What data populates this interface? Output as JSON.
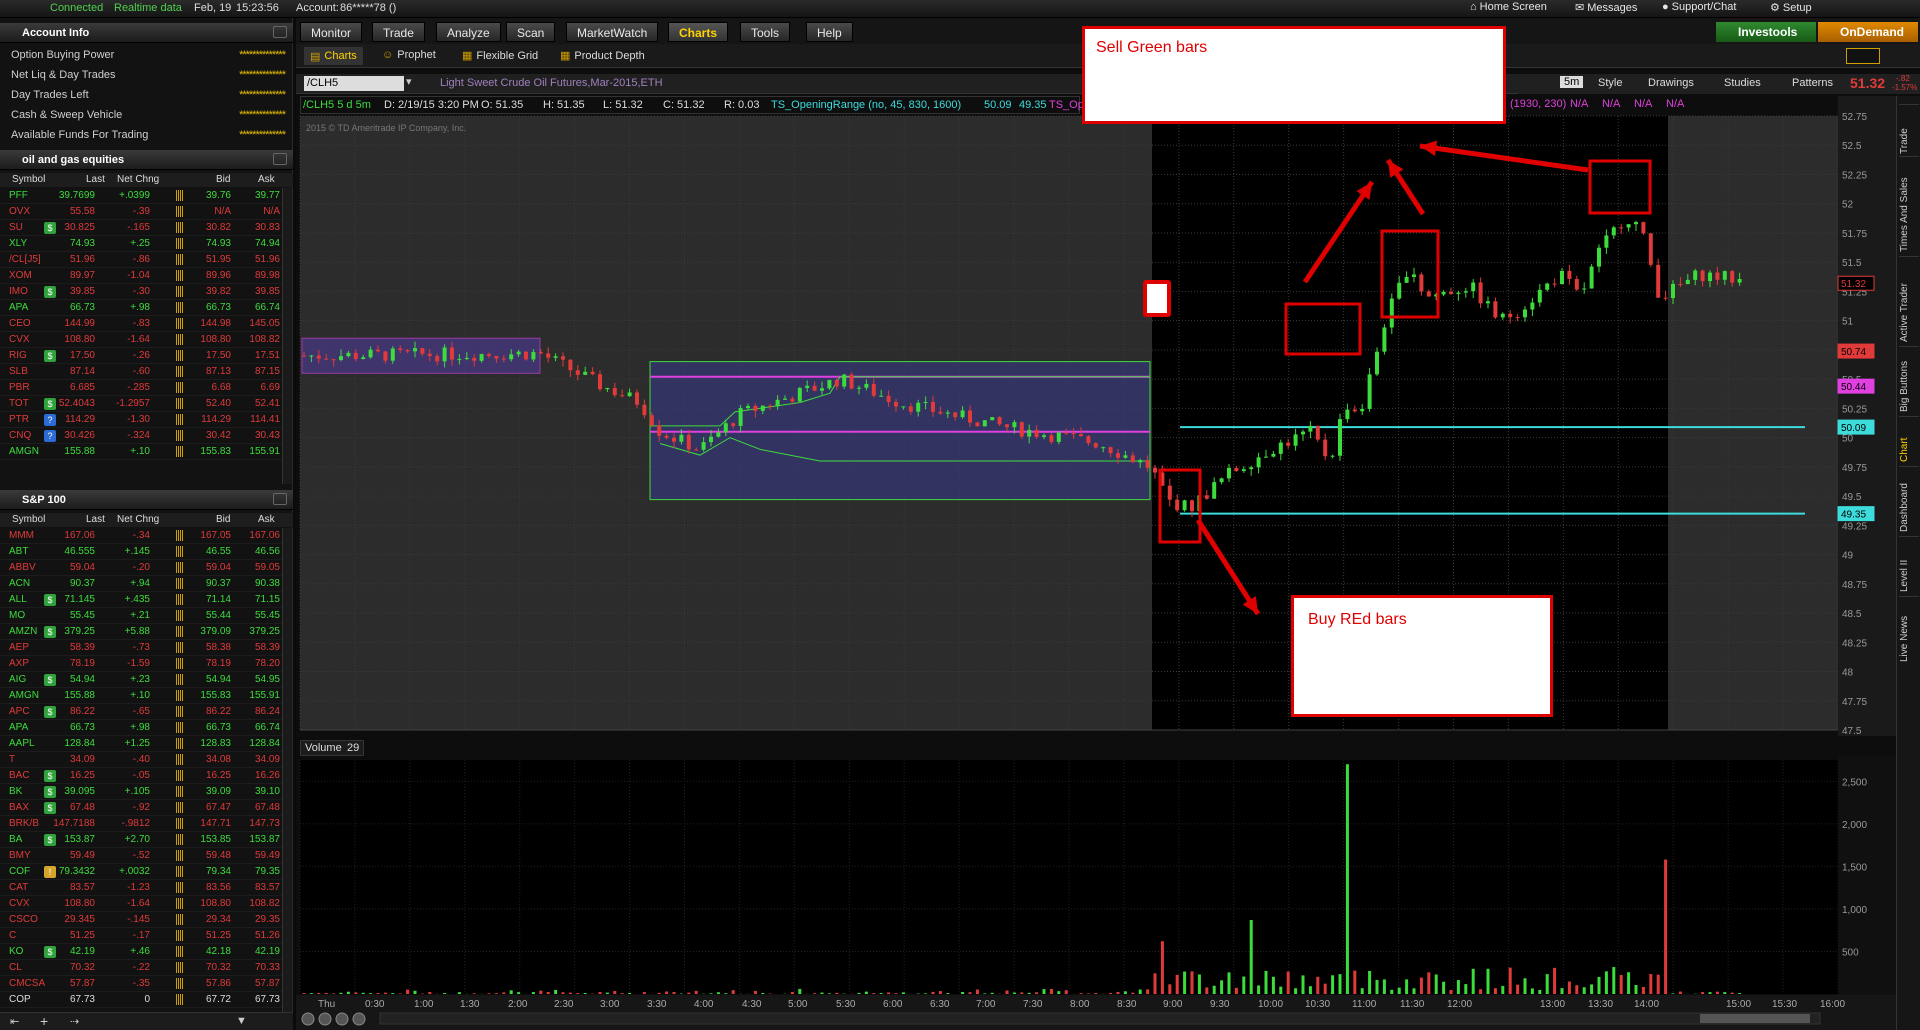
{
  "topbar": {
    "connected": "Connected",
    "realtime": "Realtime data",
    "date": "Feb, 19",
    "time": "15:23:56",
    "account_label": "Account:",
    "account": "86*****78 ()",
    "home": "Home Screen",
    "messages": "Messages",
    "support": "Support/Chat",
    "setup": "Setup"
  },
  "account_info": {
    "title": "Account Info",
    "rows": [
      {
        "label": "Option Buying Power"
      },
      {
        "label": "Net Liq & Day Trades"
      },
      {
        "label": "Day Trades Left"
      },
      {
        "label": "Cash & Sweep Vehicle"
      },
      {
        "label": "Available Funds For Trading"
      }
    ],
    "mask": "**************"
  },
  "columns": {
    "symbol": "Symbol",
    "last": "Last",
    "chg": "Net Chng",
    "bid": "Bid",
    "ask": "Ask"
  },
  "watch1": {
    "title": "oil and gas equities",
    "rows": [
      {
        "s": "PFF",
        "l": "39.7699",
        "c": "+.0399",
        "b": "39.76",
        "a": "39.77",
        "d": "up"
      },
      {
        "s": "OVX",
        "l": "55.58",
        "c": "-.39",
        "b": "N/A",
        "a": "N/A",
        "d": "dn"
      },
      {
        "s": "SU",
        "l": "30.825",
        "c": "-.165",
        "b": "30.82",
        "a": "30.83",
        "d": "dn",
        "badge": "$"
      },
      {
        "s": "XLY",
        "l": "74.93",
        "c": "+.25",
        "b": "74.93",
        "a": "74.94",
        "d": "up"
      },
      {
        "s": "/CL[J5]",
        "l": "51.96",
        "c": "-.86",
        "b": "51.95",
        "a": "51.96",
        "d": "dn"
      },
      {
        "s": "XOM",
        "l": "89.97",
        "c": "-1.04",
        "b": "89.96",
        "a": "89.98",
        "d": "dn"
      },
      {
        "s": "IMO",
        "l": "39.85",
        "c": "-.30",
        "b": "39.82",
        "a": "39.85",
        "d": "dn",
        "badge": "$"
      },
      {
        "s": "APA",
        "l": "66.73",
        "c": "+.98",
        "b": "66.73",
        "a": "66.74",
        "d": "up"
      },
      {
        "s": "CEO",
        "l": "144.99",
        "c": "-.83",
        "b": "144.98",
        "a": "145.05",
        "d": "dn"
      },
      {
        "s": "CVX",
        "l": "108.80",
        "c": "-1.64",
        "b": "108.80",
        "a": "108.82",
        "d": "dn"
      },
      {
        "s": "RIG",
        "l": "17.50",
        "c": "-.26",
        "b": "17.50",
        "a": "17.51",
        "d": "dn",
        "badge": "$"
      },
      {
        "s": "SLB",
        "l": "87.14",
        "c": "-.60",
        "b": "87.13",
        "a": "87.15",
        "d": "dn"
      },
      {
        "s": "PBR",
        "l": "6.685",
        "c": "-.285",
        "b": "6.68",
        "a": "6.69",
        "d": "dn"
      },
      {
        "s": "TOT",
        "l": "52.4043",
        "c": "-1.2957",
        "b": "52.40",
        "a": "52.41",
        "d": "dn",
        "badge": "$"
      },
      {
        "s": "PTR",
        "l": "114.29",
        "c": "-1.30",
        "b": "114.29",
        "a": "114.41",
        "d": "dn",
        "badge": "?"
      },
      {
        "s": "CNQ",
        "l": "30.426",
        "c": "-.324",
        "b": "30.42",
        "a": "30.43",
        "d": "dn",
        "badge": "?"
      },
      {
        "s": "AMGN",
        "l": "155.88",
        "c": "+.10",
        "b": "155.83",
        "a": "155.91",
        "d": "up"
      }
    ]
  },
  "watch2": {
    "title": "S&P 100",
    "rows": [
      {
        "s": "MMM",
        "l": "167.06",
        "c": "-.34",
        "b": "167.05",
        "a": "167.06",
        "d": "dn"
      },
      {
        "s": "ABT",
        "l": "46.555",
        "c": "+.145",
        "b": "46.55",
        "a": "46.56",
        "d": "up"
      },
      {
        "s": "ABBV",
        "l": "59.04",
        "c": "-.20",
        "b": "59.04",
        "a": "59.05",
        "d": "dn"
      },
      {
        "s": "ACN",
        "l": "90.37",
        "c": "+.94",
        "b": "90.37",
        "a": "90.38",
        "d": "up"
      },
      {
        "s": "ALL",
        "l": "71.145",
        "c": "+.435",
        "b": "71.14",
        "a": "71.15",
        "d": "up",
        "badge": "$"
      },
      {
        "s": "MO",
        "l": "55.45",
        "c": "+.21",
        "b": "55.44",
        "a": "55.45",
        "d": "up"
      },
      {
        "s": "AMZN",
        "l": "379.25",
        "c": "+5.88",
        "b": "379.09",
        "a": "379.25",
        "d": "up",
        "badge": "$"
      },
      {
        "s": "AEP",
        "l": "58.39",
        "c": "-.73",
        "b": "58.38",
        "a": "58.39",
        "d": "dn"
      },
      {
        "s": "AXP",
        "l": "78.19",
        "c": "-1.59",
        "b": "78.19",
        "a": "78.20",
        "d": "dn"
      },
      {
        "s": "AIG",
        "l": "54.94",
        "c": "+.23",
        "b": "54.94",
        "a": "54.95",
        "d": "up",
        "badge": "$"
      },
      {
        "s": "AMGN",
        "l": "155.88",
        "c": "+.10",
        "b": "155.83",
        "a": "155.91",
        "d": "up"
      },
      {
        "s": "APC",
        "l": "86.22",
        "c": "-.65",
        "b": "86.22",
        "a": "86.24",
        "d": "dn",
        "badge": "$"
      },
      {
        "s": "APA",
        "l": "66.73",
        "c": "+.98",
        "b": "66.73",
        "a": "66.74",
        "d": "up"
      },
      {
        "s": "AAPL",
        "l": "128.84",
        "c": "+1.25",
        "b": "128.83",
        "a": "128.84",
        "d": "up"
      },
      {
        "s": "T",
        "l": "34.09",
        "c": "-.40",
        "b": "34.08",
        "a": "34.09",
        "d": "dn"
      },
      {
        "s": "BAC",
        "l": "16.25",
        "c": "-.05",
        "b": "16.25",
        "a": "16.26",
        "d": "dn",
        "badge": "$"
      },
      {
        "s": "BK",
        "l": "39.095",
        "c": "+.105",
        "b": "39.09",
        "a": "39.10",
        "d": "up",
        "badge": "$"
      },
      {
        "s": "BAX",
        "l": "67.48",
        "c": "-.92",
        "b": "67.47",
        "a": "67.48",
        "d": "dn",
        "badge": "$"
      },
      {
        "s": "BRK/B",
        "l": "147.7188",
        "c": "-.9812",
        "b": "147.71",
        "a": "147.73",
        "d": "dn"
      },
      {
        "s": "BA",
        "l": "153.87",
        "c": "+2.70",
        "b": "153.85",
        "a": "153.87",
        "d": "up",
        "badge": "$"
      },
      {
        "s": "BMY",
        "l": "59.49",
        "c": "-.52",
        "b": "59.48",
        "a": "59.49",
        "d": "dn"
      },
      {
        "s": "COF",
        "l": "79.3432",
        "c": "+.0032",
        "b": "79.34",
        "a": "79.35",
        "d": "up",
        "badge": "!"
      },
      {
        "s": "CAT",
        "l": "83.57",
        "c": "-1.23",
        "b": "83.56",
        "a": "83.57",
        "d": "dn"
      },
      {
        "s": "CVX",
        "l": "108.80",
        "c": "-1.64",
        "b": "108.80",
        "a": "108.82",
        "d": "dn"
      },
      {
        "s": "CSCO",
        "l": "29.345",
        "c": "-.145",
        "b": "29.34",
        "a": "29.35",
        "d": "dn"
      },
      {
        "s": "C",
        "l": "51.25",
        "c": "-.17",
        "b": "51.25",
        "a": "51.26",
        "d": "dn"
      },
      {
        "s": "KO",
        "l": "42.19",
        "c": "+.46",
        "b": "42.18",
        "a": "42.19",
        "d": "up",
        "badge": "$"
      },
      {
        "s": "CL",
        "l": "70.32",
        "c": "-.22",
        "b": "70.32",
        "a": "70.33",
        "d": "dn"
      },
      {
        "s": "CMCSA",
        "l": "57.87",
        "c": "-.35",
        "b": "57.86",
        "a": "57.87",
        "d": "dn"
      },
      {
        "s": "COP",
        "l": "67.73",
        "c": "0",
        "b": "67.72",
        "a": "67.73",
        "d": "wh"
      }
    ]
  },
  "tabs": [
    "Monitor",
    "Trade",
    "Analyze",
    "Scan",
    "MarketWatch",
    "Charts",
    "Tools",
    "Help"
  ],
  "selected_tab": "Charts",
  "subtabs": [
    "Charts",
    "Prophet",
    "Flexible Grid",
    "Product Depth"
  ],
  "investools": "Investools",
  "ondemand": "OnDemand",
  "chart": {
    "symbol": "/CLH5",
    "desc": "Light Sweet Crude Oil Futures,Mar-2015,ETH",
    "period": "5m",
    "style": "Style",
    "drawings": "Drawings",
    "studies": "Studies",
    "patterns": "Patterns",
    "price": "51.32",
    "change": "-.82",
    "pct": "-1.57%",
    "info": {
      "spec": "/CLH5 5 d 5m",
      "date": "D: 2/19/15 3:20 PM",
      "open": "O: 51.35",
      "high": "H: 51.35",
      "low": "L: 51.32",
      "close": "C: 51.32",
      "range": "R: 0.03",
      "study": "TS_OpeningRange (no, 45, 830, 1600)",
      "v1": "50.09",
      "v2": "49.35",
      "study2": "TS_OpeningRange",
      "na1": "(1930, 230)",
      "na": "N/A"
    },
    "copyright": "2015 © TD Ameritrade IP Company, Inc.",
    "volume_label": "Volume",
    "volume_val": "29",
    "price_labels": {
      "last": "51.32",
      "red": "50.74",
      "mag": "50.44",
      "cyan1": "50.09",
      "cyan2": "49.35"
    },
    "side_tabs": [
      "Trade",
      "Times And Sales",
      "Active Trader",
      "Big Buttons",
      "Chart",
      "Dashboard",
      "Level II",
      "Live News"
    ],
    "annotations": {
      "sell": "Sell Green bars",
      "buy": "Buy REd bars"
    }
  },
  "chart_data": {
    "type": "candlestick",
    "y_ticks": [
      "52.75",
      "52.5",
      "52.25",
      "52",
      "51.75",
      "51.5",
      "51.25",
      "51",
      "50.75",
      "50.5",
      "50.25",
      "50",
      "49.75",
      "49.5",
      "49.25",
      "49",
      "48.75",
      "48.5",
      "48.25",
      "48",
      "47.75",
      "47.5"
    ],
    "ylim": [
      47.5,
      52.75
    ],
    "x_ticks": [
      "Thu",
      "0:30",
      "1:00",
      "1:30",
      "2:00",
      "2:30",
      "3:00",
      "3:30",
      "4:00",
      "4:30",
      "5:00",
      "5:30",
      "6:00",
      "6:30",
      "7:00",
      "7:30",
      "8:00",
      "8:30",
      "9:00",
      "9:30",
      "10:00",
      "10:30",
      "11:00",
      "11:30",
      "12:00",
      "13:00",
      "13:30",
      "14:00",
      "15:00",
      "15:30",
      "16:00"
    ],
    "vol_ticks": [
      "2,500",
      "2,000",
      "1,500",
      "1,000",
      "500"
    ],
    "vol_lim": [
      0,
      2750
    ]
  }
}
